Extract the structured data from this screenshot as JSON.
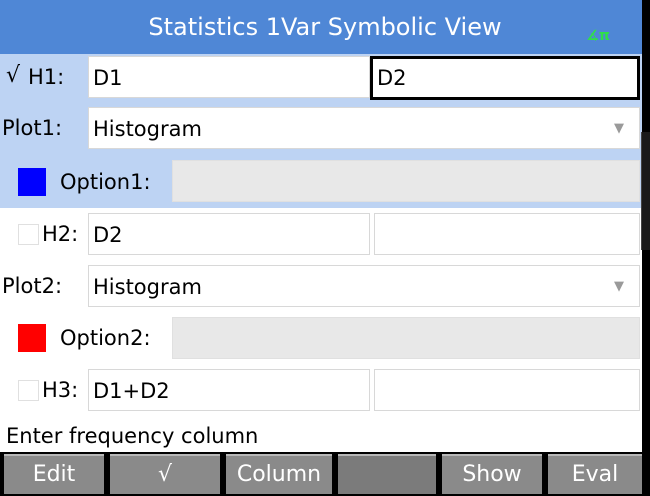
{
  "title": "Statistics 1Var Symbolic View",
  "angle_indicator": "∡π",
  "rows": {
    "h1": {
      "check": "√",
      "label": "H1:",
      "data": "D1",
      "freq": "D2"
    },
    "plot1": {
      "label": "Plot1:",
      "value": "Histogram",
      "arrow": "▼"
    },
    "option1": {
      "label": "Option1:",
      "value": "",
      "color": "#0000ff"
    },
    "h2": {
      "label": "H2:",
      "data": "D2",
      "freq": ""
    },
    "plot2": {
      "label": "Plot2:",
      "value": "Histogram",
      "arrow": "▼"
    },
    "option2": {
      "label": "Option2:",
      "value": "",
      "color": "#ff0000"
    },
    "h3": {
      "label": "H3:",
      "data": "D1+D2",
      "freq": ""
    }
  },
  "status": "Enter frequency column",
  "menu": [
    "Edit",
    "√",
    "Column",
    "",
    "Show",
    "Eval"
  ],
  "colors": {
    "titlebar": "#4f87d6",
    "selected_row": "#bdd3f3",
    "menu_button": "#8a8a8a"
  }
}
